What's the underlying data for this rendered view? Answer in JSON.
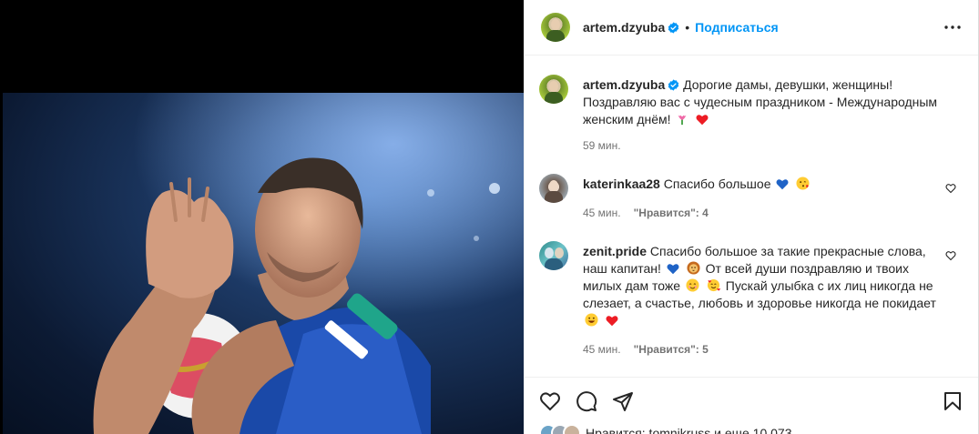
{
  "header": {
    "username": "artem.dzyuba",
    "separator": "•",
    "follow_label": "Подписаться"
  },
  "caption": {
    "username": "artem.dzyuba",
    "text_line1": "Дорогие дамы, девушки, женщины!",
    "text_line2": "Поздравляю вас с чудесным праздником - Международным",
    "text_line3": "женским днём!",
    "time": "59 мин."
  },
  "comments": [
    {
      "username": "katerinkaa28",
      "text": "Спасибо большое",
      "time": "45 мин.",
      "likes": "\"Нравится\": 4"
    },
    {
      "username": "zenit.pride",
      "line1": "Спасибо большое за такие прекрасные слова,",
      "line2a": "наш капитан!",
      "line2b": "От всей души поздравляю и твоих",
      "line3a": "милых дам тоже",
      "line3b": "Пускай улыбка с их лиц никогда не",
      "line4": "слезает, а счастье, любовь и здоровье никогда не покидает",
      "time": "45 мин.",
      "likes": "\"Нравится\": 5"
    }
  ],
  "likes_bar": {
    "text": "Нравится: tomnikruss и еще 10 073"
  },
  "icons": {
    "verified": "verified-badge-icon",
    "more": "more-options-icon",
    "like": "heart-icon",
    "comment": "comment-icon",
    "share": "share-icon",
    "save": "bookmark-icon"
  },
  "colors": {
    "accent": "#0095f6",
    "verified": "#0095f6",
    "muted": "#737373",
    "text": "#262626",
    "heart_red": "#ed1c24",
    "heart_blue": "#1f63c6"
  }
}
